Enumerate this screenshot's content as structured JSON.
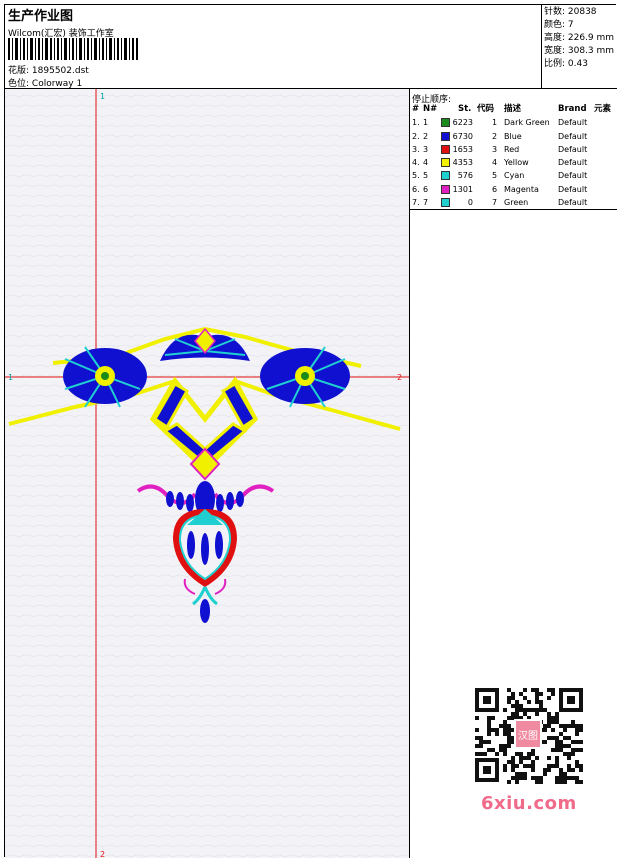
{
  "header": {
    "title": "生产作业图",
    "company": "Wilcom(汇宏) 装饰工作室",
    "design_label": "花版:",
    "design_file": "1895502.dst",
    "colorway_label": "色位:",
    "colorway": "Colorway 1"
  },
  "stats": {
    "stitches": "针数: 20838",
    "colors": "颜色: 7",
    "height": "高度: 226.9 mm",
    "width": "宽度: 308.3 mm",
    "scale": "比例: 0.43"
  },
  "axes": {
    "top_h": "1",
    "bottom_v": "2",
    "left_v": "1",
    "right_h": "2"
  },
  "stop_sequence": {
    "title": "停止顺序:",
    "headers": {
      "num": "#",
      "no": "N#",
      "st": "St.",
      "code": "代码",
      "desc": "描述",
      "brand": "Brand",
      "element": "元素"
    },
    "rows": [
      {
        "num": "1.",
        "no": "1",
        "color": "#1a8a1a",
        "st": "6223",
        "code": "1",
        "desc": "Dark Green",
        "brand": "Default"
      },
      {
        "num": "2.",
        "no": "2",
        "color": "#1010d0",
        "st": "6730",
        "code": "2",
        "desc": "Blue",
        "brand": "Default"
      },
      {
        "num": "3.",
        "no": "3",
        "color": "#e01010",
        "st": "1653",
        "code": "3",
        "desc": "Red",
        "brand": "Default"
      },
      {
        "num": "4.",
        "no": "4",
        "color": "#f0f000",
        "st": "4353",
        "code": "4",
        "desc": "Yellow",
        "brand": "Default"
      },
      {
        "num": "5.",
        "no": "5",
        "color": "#20d0d0",
        "st": "576",
        "code": "5",
        "desc": "Cyan",
        "brand": "Default"
      },
      {
        "num": "6.",
        "no": "6",
        "color": "#e020c0",
        "st": "1301",
        "code": "6",
        "desc": "Magenta",
        "brand": "Default"
      },
      {
        "num": "7.",
        "no": "7",
        "color": "#20d0d0",
        "st": "0",
        "code": "7",
        "desc": "Green",
        "brand": "Default"
      }
    ]
  },
  "watermark": "6xiu.com",
  "qr_center_text": "汉图"
}
